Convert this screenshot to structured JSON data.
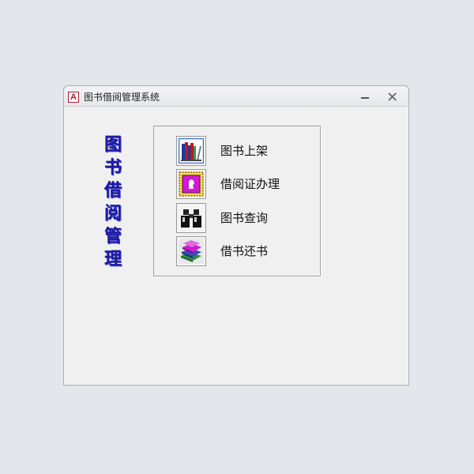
{
  "window": {
    "title": "图书借阅管理系统",
    "app_icon_letter": "A"
  },
  "side_title": "图书借阅管理",
  "menu": {
    "items": [
      {
        "label": "图书上架",
        "icon": "books-shelf-icon"
      },
      {
        "label": "借阅证办理",
        "icon": "stamp-card-icon"
      },
      {
        "label": "图书查询",
        "icon": "binoculars-icon"
      },
      {
        "label": "借书还书",
        "icon": "book-stack-icon"
      }
    ]
  },
  "colors": {
    "side_title": "#1a1aa0",
    "icon_magenta": "#d21ad2",
    "icon_frame": "#3a6fd0"
  }
}
